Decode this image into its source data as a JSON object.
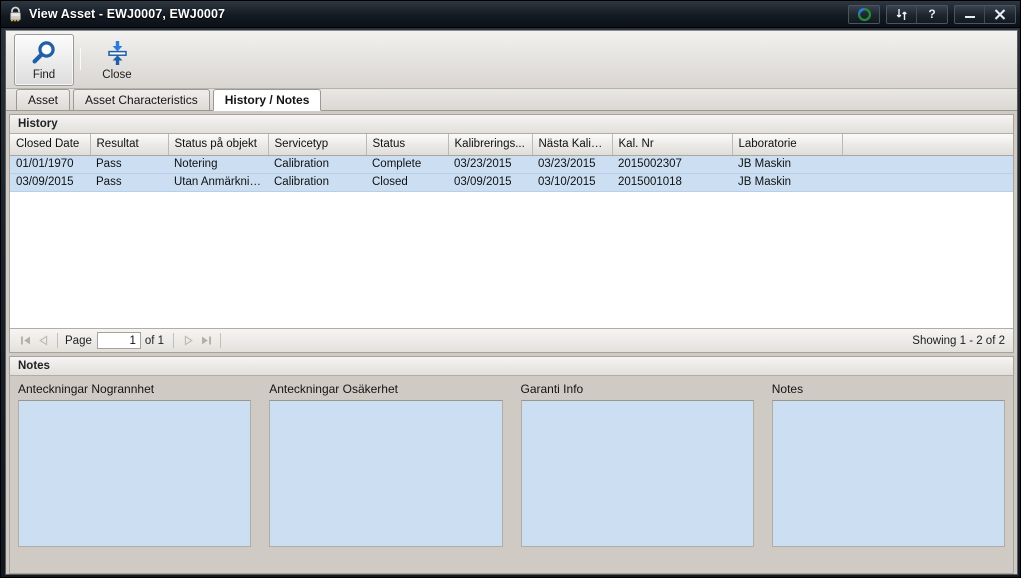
{
  "window": {
    "title": "View Asset - EWJ0007, EWJ0007",
    "icon": "lock-icon",
    "controls": [
      {
        "name": "history-button",
        "glyph": "history-icon"
      },
      {
        "name": "sync-button",
        "glyph": "sync-icon"
      },
      {
        "name": "help-button",
        "glyph": "?"
      },
      {
        "name": "minimize-button",
        "glyph": "minimize-icon"
      },
      {
        "name": "close-button",
        "glyph": "close-icon"
      }
    ]
  },
  "toolbar": {
    "find_label": "Find",
    "close_label": "Close"
  },
  "tabs": [
    {
      "label": "Asset",
      "active": false
    },
    {
      "label": "Asset Characteristics",
      "active": false
    },
    {
      "label": "History / Notes",
      "active": true
    }
  ],
  "history": {
    "header": "History",
    "columns": [
      "Closed Date",
      "Resultat",
      "Status på objekt",
      "Servicetyp",
      "Status",
      "Kalibrerings...",
      "Nästa Kalibr...",
      "Kal. Nr",
      "Laboratorie",
      ""
    ],
    "rows": [
      {
        "closed_date": "01/01/1970",
        "resultat": "Pass",
        "status_pa_objekt": "Notering",
        "servicetyp": "Calibration",
        "status": "Complete",
        "kalibrerings": "03/23/2015",
        "nasta_kalibr": "03/23/2015",
        "kal_nr": "2015002307",
        "laboratorie": "JB Maskin",
        "blank": ""
      },
      {
        "closed_date": "03/09/2015",
        "resultat": "Pass",
        "status_pa_objekt": "Utan Anmärkning",
        "servicetyp": "Calibration",
        "status": "Closed",
        "kalibrerings": "03/09/2015",
        "nasta_kalibr": "03/10/2015",
        "kal_nr": "2015001018",
        "laboratorie": "JB Maskin",
        "blank": ""
      }
    ]
  },
  "pager": {
    "first_glyph": "⏮",
    "prev_glyph": "◀",
    "page_label": "Page",
    "page_value": "1",
    "of_label": "of 1",
    "next_glyph": "▶",
    "last_glyph": "⏭",
    "showing": "Showing 1 - 2 of 2"
  },
  "notes": {
    "header": "Notes",
    "fields": [
      {
        "label": "Anteckningar Nogrannhet",
        "value": ""
      },
      {
        "label": "Anteckningar Osäkerhet",
        "value": ""
      },
      {
        "label": "Garanti Info",
        "value": ""
      },
      {
        "label": "Notes",
        "value": ""
      }
    ]
  },
  "colors": {
    "accent_blue": "#1f5fa9",
    "row_blue": "#cbdef2",
    "chrome_grey": "#cfcac4",
    "titlebar": "#141a22"
  }
}
